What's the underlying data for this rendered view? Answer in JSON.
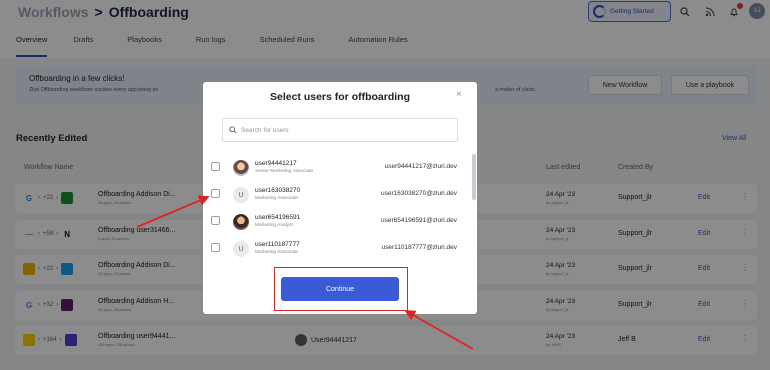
{
  "header": {
    "breadcrumb": [
      "Workflows",
      ">",
      "Offboarding"
    ],
    "getting_started_label": "Getting Started",
    "avatar_initials": "AJ"
  },
  "tabs": [
    "Overview",
    "Drafts",
    "Playbooks",
    "Run logs",
    "Scheduled Runs",
    "Automation Rules"
  ],
  "active_tab": "Overview",
  "banner": {
    "title": "Offboarding in a few clicks!",
    "subtitle_left": "Zluri Offboarding workflows curates every app being us",
    "subtitle_right": "a matter of clicks.",
    "new_workflow_label": "New Workflow",
    "use_playbook_label": "Use a playbook"
  },
  "section": {
    "title": "Recently Edited",
    "view_all_label": "View All",
    "columns": {
      "workflow_name": "Workflow Name",
      "last_edited": "Last edited",
      "created_by": "Created By"
    }
  },
  "rows": [
    {
      "apps_count": "+22",
      "name": "Offboarding Addison Di...",
      "meta": "24 apps, 26 actions",
      "last_edited": "24 Apr '23",
      "last_edited_sub": "by support_jlr",
      "created_by": "Support_jlr",
      "edit_label": "Edit"
    },
    {
      "apps_count": "+58",
      "name": "Offboarding user31466...",
      "meta": "6 apps, 26 actions",
      "last_edited": "24 Apr '23",
      "last_edited_sub": "by support_jlr",
      "created_by": "Support_jlr",
      "edit_label": "Edit"
    },
    {
      "apps_count": "+22",
      "name": "Offboarding Addison Di...",
      "meta": "24 apps, 26 actions",
      "last_edited": "24 Apr '23",
      "last_edited_sub": "by support_jlr",
      "created_by": "Support_jlr",
      "edit_label": "Edit"
    },
    {
      "apps_count": "+32",
      "name": "Offboarding Addison H...",
      "meta": "24 apps, 26 actions",
      "last_edited": "24 Apr '23",
      "last_edited_sub": "by support_jlr",
      "created_by": "Support_jlr",
      "edit_label": "Edit"
    },
    {
      "apps_count": "+164",
      "name": "Offboarding user94441...",
      "meta": "130 apps, 136 actions",
      "user": "User94441217",
      "last_edited": "24 Apr '23",
      "last_edited_sub": "by Jeff B",
      "created_by": "Jeff B",
      "edit_label": "Edit"
    }
  ],
  "modal": {
    "title": "Select users for offboarding",
    "close_label": "×",
    "search_placeholder": "Search for users",
    "continue_label": "Continue",
    "users": [
      {
        "name": "user94441217",
        "title": "Senior Marketing Associate",
        "email": "user94441217@zluri.dev",
        "avatar": "photo-1"
      },
      {
        "name": "user163038270",
        "title": "Marketing Associate",
        "email": "user163038270@zluri.dev",
        "avatar": "U"
      },
      {
        "name": "user654196591",
        "title": "Marketing Analyst",
        "email": "user654196591@zluri.dev",
        "avatar": "photo-2"
      },
      {
        "name": "user110187777",
        "title": "Marketing Associate",
        "email": "user110187777@zluri.dev",
        "avatar": "U"
      }
    ]
  },
  "colors": {
    "accent": "#3b5bd6",
    "annotation": "#e02222",
    "banner_bg": "#e7eefb"
  }
}
